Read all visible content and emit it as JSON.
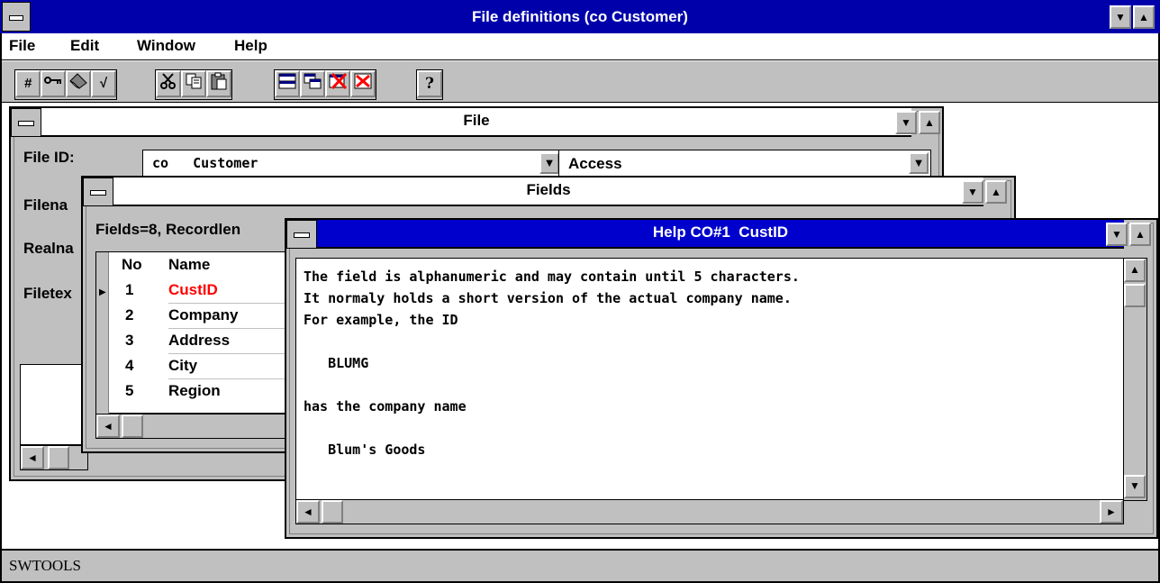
{
  "app": {
    "title": "File definitions (co Customer)",
    "status_text": "SWTOOLS"
  },
  "menu": [
    {
      "label": "File"
    },
    {
      "label": "Edit"
    },
    {
      "label": "Window"
    },
    {
      "label": "Help"
    }
  ],
  "toolbar": {
    "groups": [
      [
        "hash-icon",
        "key-icon",
        "clear-icon",
        "check-icon"
      ],
      [
        "cut-icon",
        "copy-icon",
        "paste-icon"
      ],
      [
        "tile-icon",
        "cascade-icon",
        "delete-window-icon",
        "close-all-icon"
      ],
      [
        "help-icon"
      ]
    ]
  },
  "file_window": {
    "title": "File",
    "file_id_label": "File ID:",
    "file_id_value": "co   Customer",
    "access_value": "Access",
    "filename_label": "Filena",
    "realname_label": "Realna",
    "filetext_label": "Filetex"
  },
  "fields_window": {
    "title": "Fields",
    "summary": "Fields=8, Recordlen",
    "col_no": "No",
    "col_name": "Name",
    "rows": [
      {
        "no": "1",
        "name": "CustID",
        "selected": true
      },
      {
        "no": "2",
        "name": "Company"
      },
      {
        "no": "3",
        "name": "Address"
      },
      {
        "no": "4",
        "name": "City"
      },
      {
        "no": "5",
        "name": "Region"
      }
    ]
  },
  "help_window": {
    "title": "Help CO#1  CustID",
    "lines": [
      "The field is alphanumeric and may contain until 5 characters.",
      "It normaly holds a short version of the actual company name.",
      "For example, the ID",
      "",
      "   BLUMG",
      "",
      "has the company name",
      "",
      "   Blum's Goods"
    ]
  },
  "colors": {
    "title_active": "#0000aa",
    "selected_text": "#ff0000",
    "chrome": "#c0c0c0"
  }
}
